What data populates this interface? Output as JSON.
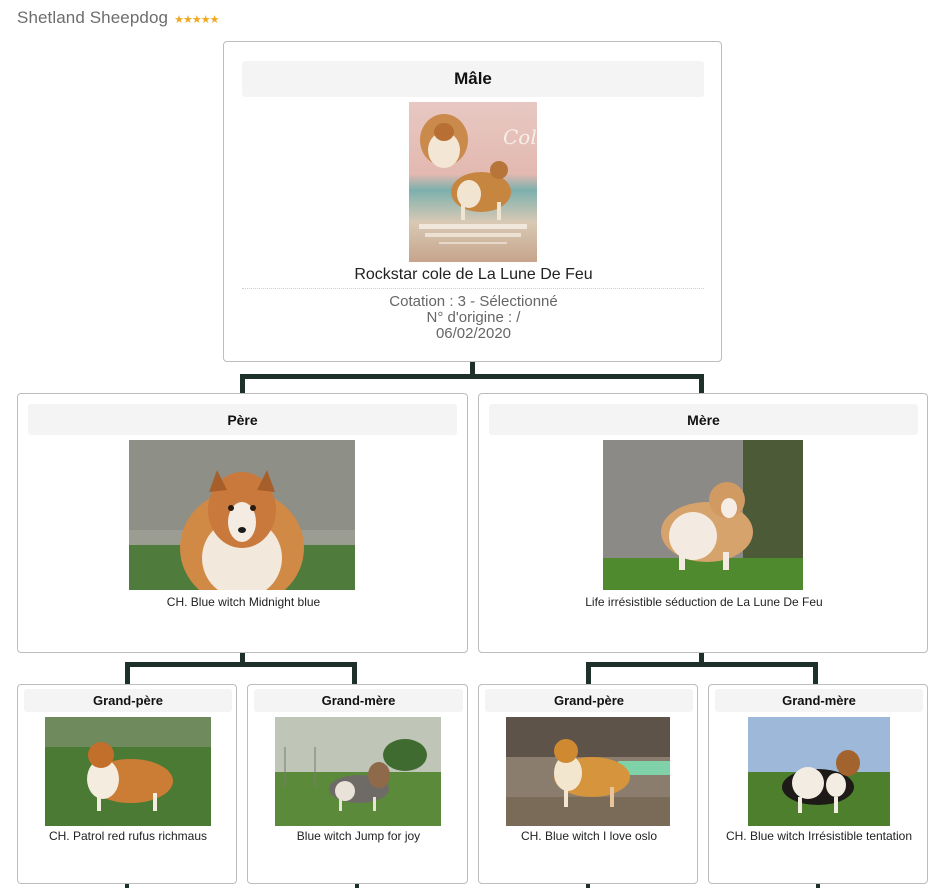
{
  "page": {
    "title": "Shetland Sheepdog",
    "rating_stars": 5,
    "star_glyph": "★",
    "star_color": "#f0a81e"
  },
  "subject": {
    "header": "Mâle",
    "name": "Rockstar cole de La Lune De Feu",
    "cotation": "Cotation : 3 - Sélectionné",
    "origin": "N° d'origine : /",
    "date": "06/02/2020",
    "photo": "dog-poster-photo"
  },
  "parents": {
    "father": {
      "header": "Père",
      "name": "CH. Blue witch Midnight blue",
      "photo": "dog-portrait-photo"
    },
    "mother": {
      "header": "Mère",
      "name": "Life irrésistible séduction de La Lune De Feu",
      "photo": "dog-standing-photo"
    }
  },
  "grandparents": [
    {
      "header": "Grand-père",
      "name": "CH. Patrol red rufus richmaus",
      "photo": "dog-show-stack-photo"
    },
    {
      "header": "Grand-mère",
      "name": "Blue witch Jump for joy",
      "photo": "dog-field-photo"
    },
    {
      "header": "Grand-père",
      "name": "CH. Blue witch I love oslo",
      "photo": "dog-ring-photo"
    },
    {
      "header": "Grand-mère",
      "name": "CH. Blue witch Irrésistible tentation",
      "photo": "dog-tricolor-photo"
    }
  ],
  "colors": {
    "connector": "#1d3029",
    "card_border": "#bdbdbd",
    "header_bg": "#f4f4f4"
  }
}
